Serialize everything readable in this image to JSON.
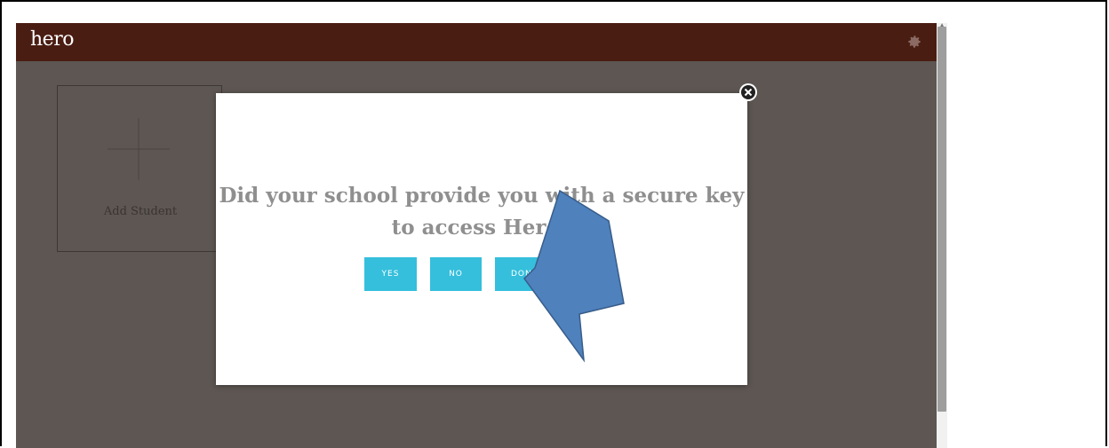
{
  "app": {
    "logo_text": "hero"
  },
  "header": {
    "settings_icon": "gear-icon"
  },
  "student_card": {
    "label": "Add Student",
    "icon": "plus-icon"
  },
  "modal": {
    "question": "Did your school provide you with a secure key to access Hero?",
    "buttons": {
      "yes": "YES",
      "no": "NO",
      "dont": "DON'T KNOW"
    },
    "close_icon": "close-icon"
  },
  "annotation": {
    "icon": "arrow-annotation",
    "color": "#4f81bd"
  },
  "colors": {
    "header_bg": "#4a1d12",
    "overlay_bg": "#5d5652",
    "button_bg": "#35bfdc",
    "question_text": "#8f8f8f"
  }
}
